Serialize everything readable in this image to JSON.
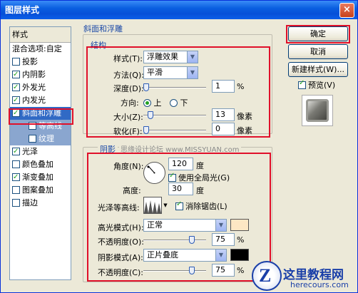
{
  "window": {
    "title": "图层样式",
    "close_glyph": "×"
  },
  "left_panel": {
    "header": "样式",
    "items": [
      {
        "label": "混合选项:自定",
        "checkbox": false,
        "checked": false
      },
      {
        "label": "投影",
        "checkbox": true,
        "checked": false
      },
      {
        "label": "内阴影",
        "checkbox": true,
        "checked": true
      },
      {
        "label": "外发光",
        "checkbox": true,
        "checked": true
      },
      {
        "label": "内发光",
        "checkbox": true,
        "checked": true
      },
      {
        "label": "斜面和浮雕",
        "checkbox": true,
        "checked": true,
        "selected": true
      },
      {
        "label": "等高线",
        "checkbox": true,
        "checked": false,
        "sub": true
      },
      {
        "label": "纹理",
        "checkbox": true,
        "checked": false,
        "sub": true
      },
      {
        "label": "光泽",
        "checkbox": true,
        "checked": true
      },
      {
        "label": "颜色叠加",
        "checkbox": true,
        "checked": false
      },
      {
        "label": "渐变叠加",
        "checkbox": true,
        "checked": true
      },
      {
        "label": "图案叠加",
        "checkbox": true,
        "checked": false
      },
      {
        "label": "描边",
        "checkbox": true,
        "checked": false
      }
    ]
  },
  "bevel": {
    "section_title": "斜面和浮雕",
    "structure": {
      "title": "结构",
      "style_label": "样式(T):",
      "style_value": "浮雕效果",
      "technique_label": "方法(Q):",
      "technique_value": "平滑",
      "depth_label": "深度(D):",
      "depth_value": "1",
      "depth_unit": "%",
      "direction_label": "方向:",
      "direction_up": "上",
      "direction_down": "下",
      "size_label": "大小(Z):",
      "size_value": "13",
      "size_unit": "像素",
      "soften_label": "软化(F):",
      "soften_value": "0",
      "soften_unit": "像素"
    },
    "shading": {
      "title": "阴影",
      "watermark": "思缘设计论坛 www.MISSYUAN.com",
      "angle_label": "角度(N):",
      "angle_value": "120",
      "angle_unit": "度",
      "global_light_label": "使用全局光(G)",
      "altitude_label": "高度:",
      "altitude_value": "30",
      "altitude_unit": "度",
      "gloss_label": "光泽等高线:",
      "antialias_label": "消除锯齿(L)",
      "highlight_mode_label": "高光模式(H):",
      "highlight_mode_value": "正常",
      "highlight_color": "#fde7c4",
      "highlight_opacity_label": "不透明度(O):",
      "highlight_opacity_value": "75",
      "highlight_opacity_unit": "%",
      "shadow_mode_label": "阴影模式(A):",
      "shadow_mode_value": "正片叠底",
      "shadow_color": "#000000",
      "shadow_opacity_label": "不透明度(C):",
      "shadow_opacity_value": "75",
      "shadow_opacity_unit": "%"
    }
  },
  "buttons": {
    "ok": "确定",
    "cancel": "取消",
    "new_style": "新建样式(W)...",
    "preview": "预览(V)"
  },
  "logo": {
    "text": "这里教程网",
    "url": "herecours.com"
  },
  "colors": {
    "accent_red": "#e0102a",
    "title_blue": "#0a5fe0",
    "selected": "#316ac5"
  }
}
